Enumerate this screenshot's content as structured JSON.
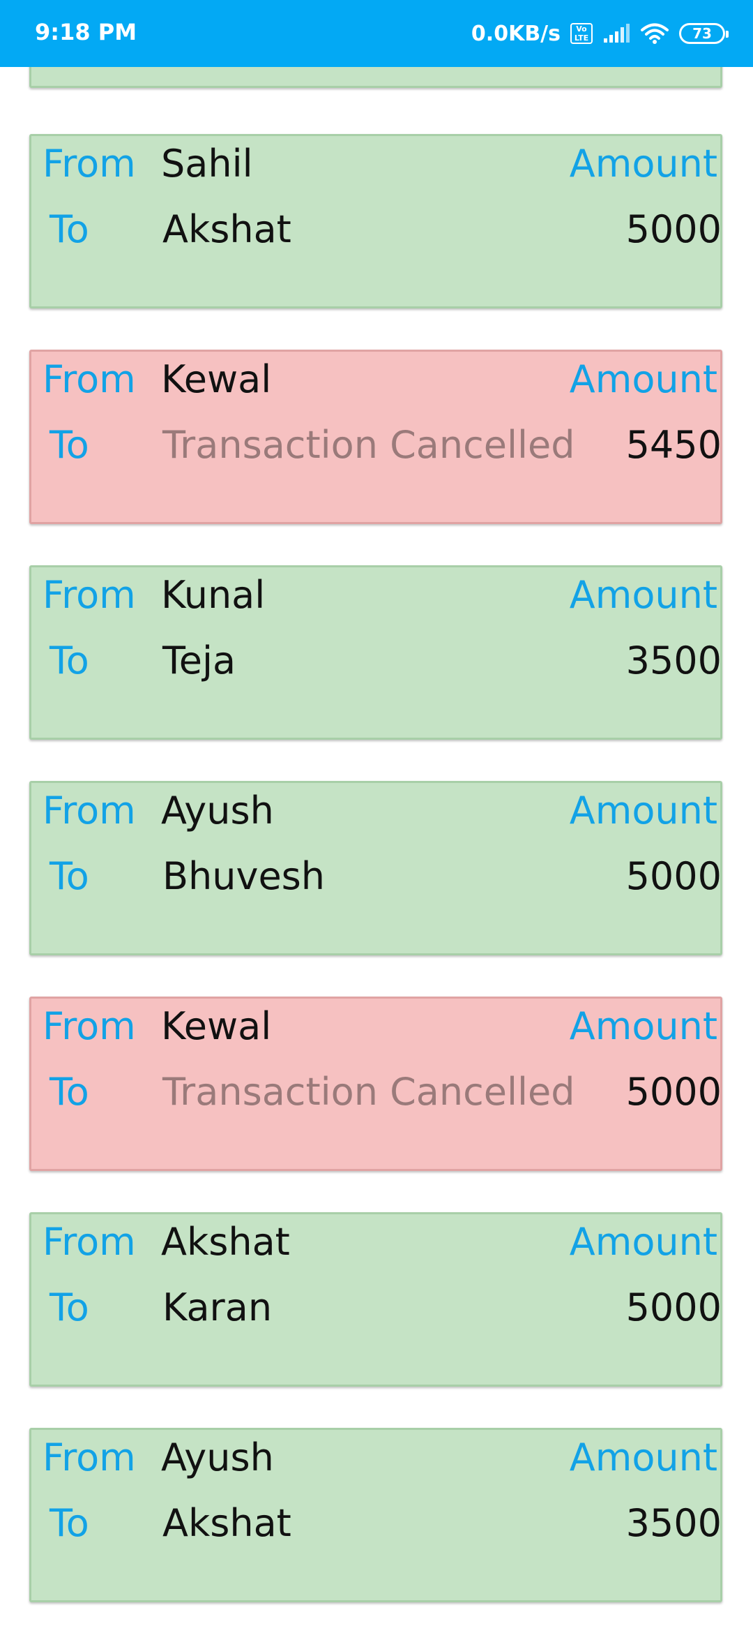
{
  "status_bar": {
    "time": "9:18 PM",
    "net_speed": "0.0KB/s",
    "volte": "Vo LTE",
    "battery": "73",
    "icons": [
      "volte-icon",
      "signal-icon",
      "wifi-icon",
      "battery-icon"
    ]
  },
  "labels": {
    "from": "From",
    "to": "To",
    "amount": "Amount"
  },
  "colors": {
    "status_bar": "#03A9F4",
    "label_blue": "#12A2E6",
    "success_card": "#C5E3C5",
    "cancelled_card": "#F6C1C1"
  },
  "transactions": [
    {
      "from": "Sahil",
      "to": "Akshat",
      "amount": "5000",
      "status": "success"
    },
    {
      "from": "Kewal",
      "to": "Transaction Cancelled",
      "amount": "5450",
      "status": "cancelled"
    },
    {
      "from": "Kunal",
      "to": "Teja",
      "amount": "3500",
      "status": "success"
    },
    {
      "from": "Ayush",
      "to": "Bhuvesh",
      "amount": "5000",
      "status": "success"
    },
    {
      "from": "Kewal",
      "to": "Transaction Cancelled",
      "amount": "5000",
      "status": "cancelled"
    },
    {
      "from": "Akshat",
      "to": "Karan",
      "amount": "5000",
      "status": "success"
    },
    {
      "from": "Ayush",
      "to": "Akshat",
      "amount": "3500",
      "status": "success"
    }
  ]
}
